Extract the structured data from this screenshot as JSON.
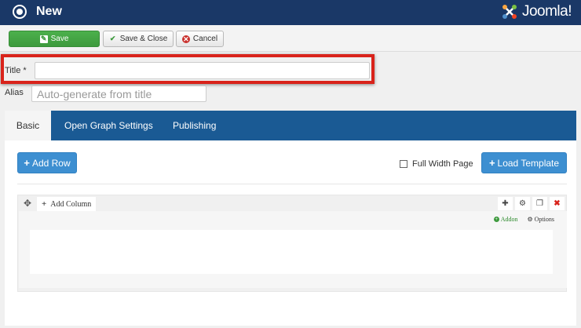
{
  "header": {
    "title": "New",
    "logo_text": "Joomla!"
  },
  "toolbar": {
    "save_label": "Save",
    "save_close_label": "Save & Close",
    "cancel_label": "Cancel"
  },
  "form": {
    "title_label": "Title *",
    "title_value": "",
    "alias_label": "Alias",
    "alias_placeholder": "Auto-generate from title"
  },
  "tabs": [
    {
      "label": "Basic",
      "active": true
    },
    {
      "label": "Open Graph Settings",
      "active": false
    },
    {
      "label": "Publishing",
      "active": false
    }
  ],
  "builder": {
    "add_row_label": "Add Row",
    "full_width_label": "Full Width Page",
    "full_width_checked": false,
    "load_template_label": "Load Template",
    "add_column_label": "Add Column",
    "addon_label": "Addon",
    "options_label": "Options"
  },
  "colors": {
    "header_bg": "#1a3867",
    "tab_bar_bg": "#1a5a94",
    "save_green": "#4cb04c",
    "primary_blue": "#3d8fd1",
    "highlight_red": "#d9231b"
  }
}
